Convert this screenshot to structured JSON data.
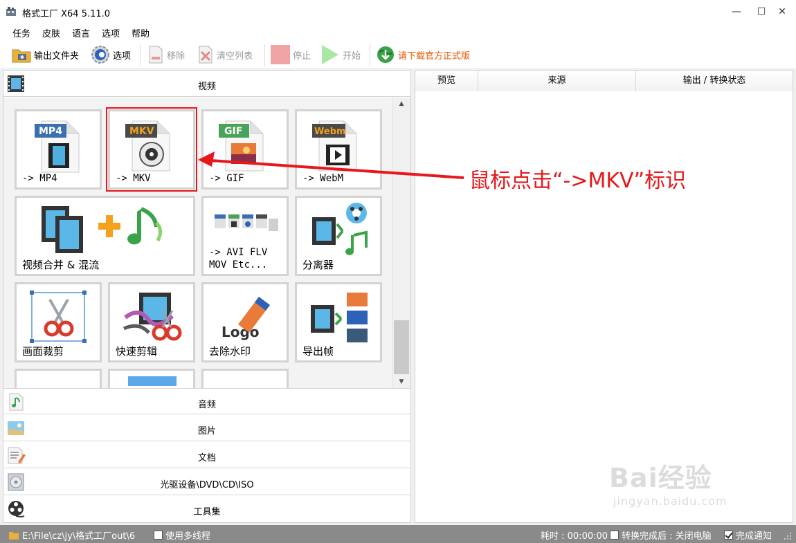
{
  "window": {
    "title": "格式工厂 X64 5.11.0",
    "minimize_glyph": "—",
    "maximize_glyph": "☐",
    "close_glyph": "✕"
  },
  "menu": [
    "任务",
    "皮肤",
    "语言",
    "选项",
    "帮助"
  ],
  "toolbar": {
    "output_folder": "输出文件夹",
    "options": "选项",
    "remove": "移除",
    "clear_list": "清空列表",
    "stop": "停止",
    "start": "开始",
    "download_official": "请下载官方正式版"
  },
  "categories": {
    "video": "视频",
    "audio": "音频",
    "image": "图片",
    "document": "文档",
    "disc": "光驱设备\\DVD\\CD\\ISO",
    "tools": "工具集"
  },
  "tiles": {
    "mp4": {
      "badge": "MP4",
      "label": "-> MP4",
      "badge_color": "#3d6fb0"
    },
    "mkv": {
      "badge": "MKV",
      "label": "-> MKV",
      "badge_color": "#4a4a4a"
    },
    "gif": {
      "badge": "GIF",
      "label": "-> GIF",
      "badge_color": "#4aa35a"
    },
    "webm": {
      "badge": "Webm",
      "label": "-> WebM",
      "badge_color": "#4a4a4a"
    },
    "merge": {
      "label": "视频合并 & 混流"
    },
    "avi": {
      "label_line1": "-> AVI FLV",
      "label_line2": "MOV Etc..."
    },
    "splitter": {
      "label": "分离器"
    },
    "crop": {
      "label": "画面裁剪"
    },
    "quick_cut": {
      "label": "快速剪辑"
    },
    "remove_watermark": {
      "label": "去除水印",
      "logo_text": "Logo"
    },
    "export_frames": {
      "label": "导出帧"
    }
  },
  "queue_columns": [
    "预览",
    "来源",
    "输出 / 转换状态"
  ],
  "statusbar": {
    "output_path": "E:\\File\\cz\\jy\\格式工厂out\\6",
    "multithread": "使用多线程",
    "elapsed": "耗时 : 00:00:00",
    "after_convert": "转换完成后 : 关闭电脑",
    "notify": "完成通知"
  },
  "annotation": {
    "text": "鼠标点击“->MKV”标识",
    "color": "#e8171b"
  },
  "watermark": {
    "logo": "Bai经验",
    "url": "jingyan.baidu.com"
  }
}
